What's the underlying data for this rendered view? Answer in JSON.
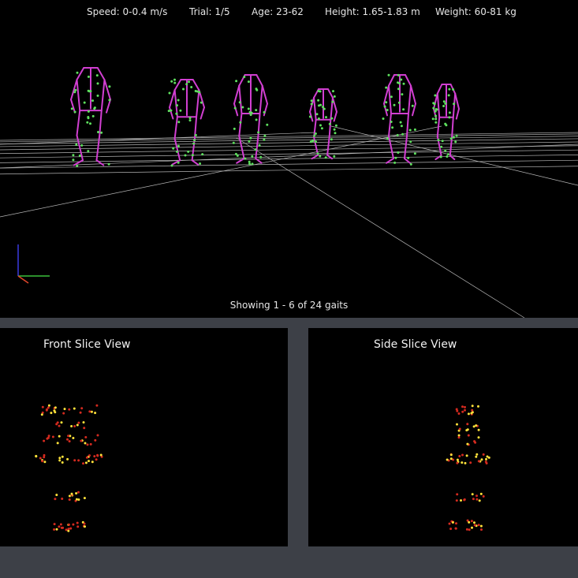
{
  "info": {
    "speed": "Speed: 0-0.4 m/s",
    "trial": "Trial: 1/5",
    "age": "Age: 23-62",
    "height": "Height: 1.65-1.83 m",
    "weight": "Weight: 60-81 kg"
  },
  "status": {
    "showing": "Showing 1 - 6 of 24 gaits"
  },
  "panels": {
    "front_title": "Front Slice View",
    "side_title": "Side Slice View"
  },
  "colors": {
    "skeleton": "#d13fd1",
    "markers": "#5ee05e",
    "grid": "#c8c8c8",
    "slice_red": "#d42a1f",
    "slice_yellow": "#ffe23a",
    "axis_x": "#3bbf3b",
    "axis_y": "#3a3ae0",
    "axis_z": "#e0462a",
    "panel_bg": "#000000",
    "app_bg": "#3d4047"
  },
  "gait_count_displayed": 6
}
